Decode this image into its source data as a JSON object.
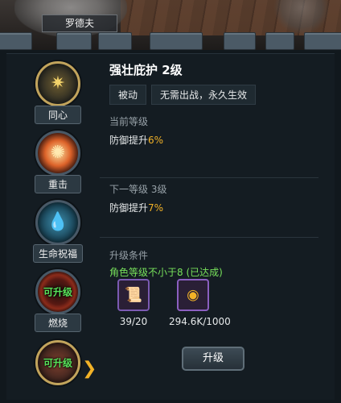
{
  "character": {
    "name": "罗德夫"
  },
  "skills": [
    {
      "label": "同心",
      "icon": "star-icon",
      "glyph": "✷",
      "glyph_color": "#f3d36a",
      "upgradable": ""
    },
    {
      "label": "重击",
      "icon": "burst-icon",
      "glyph": "✺",
      "glyph_color": "#ff9a3c",
      "upgradable": ""
    },
    {
      "label": "生命祝福",
      "icon": "water-drop-icon",
      "glyph": "💧",
      "glyph_color": "#7fe6ff",
      "upgradable": ""
    },
    {
      "label": "燃烧",
      "icon": "flame-ring-icon",
      "glyph": "◎",
      "glyph_color": "#c23b2b",
      "upgradable": "可升级"
    },
    {
      "label": "",
      "icon": "shield-icon",
      "glyph": "▣",
      "glyph_color": "#a8553b",
      "upgradable": "可升级"
    }
  ],
  "skill_detail": {
    "title": "强壮庇护 2级",
    "tags": [
      "被动",
      "无需出战，永久生效"
    ],
    "current": {
      "heading": "当前等级",
      "text": "防御提升",
      "value": "6%"
    },
    "next": {
      "heading": "下一等级 3级",
      "text": "防御提升",
      "value": "7%"
    },
    "requirement": {
      "heading": "升级条件",
      "text": "角色等级不小于8 (已达成)"
    },
    "items": [
      {
        "icon": "scroll-book-icon",
        "count": "39/20"
      },
      {
        "icon": "gold-coin-icon",
        "count": "294.6K/1000"
      }
    ],
    "upgrade_label": "升级"
  },
  "colors": {
    "accent": "#f2b227",
    "success": "#77e05b",
    "upgradable": "#58e35a"
  }
}
